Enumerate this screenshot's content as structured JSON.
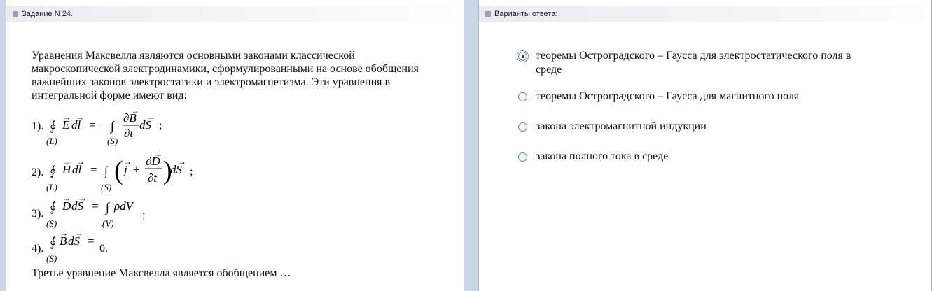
{
  "task_panel": {
    "header": "Задание N 24.",
    "question": "Уравнения Максвелла являются основными законами классической макроскопической электродинамики, сформулированными на основе обобщения важнейших законов электростатики и электромагнетизма. Эти уравнения в интегральной форме имеют вид:",
    "formula_labels": [
      "1).",
      "2).",
      "3).",
      "4)."
    ],
    "formula_tail": [
      "0."
    ],
    "closing": "Третье уравнение Максвелла является обобщением …"
  },
  "answers_panel": {
    "header": "Варианты ответа:",
    "options": [
      {
        "label": "теоремы Остроградского – Гаусса для электростатического поля в среде",
        "selected": true
      },
      {
        "label": "теоремы Остроградского – Гаусса для магнитного поля",
        "selected": false
      },
      {
        "label": "закона электромагнитной индукции",
        "selected": false
      },
      {
        "label": "закона полного тока в среде",
        "selected": false
      }
    ]
  }
}
